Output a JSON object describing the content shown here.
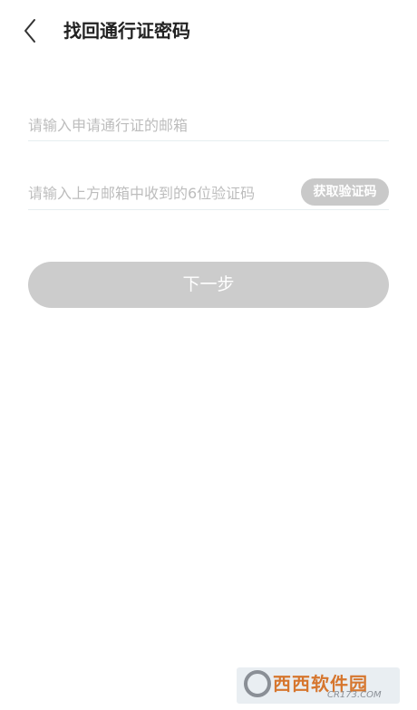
{
  "header": {
    "title": "找回通行证密码",
    "back_icon": "chevron-left-icon"
  },
  "form": {
    "email_placeholder": "请输入申请通行证的邮箱",
    "email_value": "",
    "code_placeholder": "请输入上方邮箱中收到的6位验证码",
    "code_value": "",
    "get_code_label": "获取验证码",
    "next_label": "下一步"
  },
  "watermark": {
    "brand": "西西软件园",
    "domain": "CR173.COM"
  },
  "colors": {
    "background": "#ffffff",
    "button_disabled": "#cccccc",
    "placeholder": "#bdbdbd",
    "divider": "#e6eef0"
  }
}
